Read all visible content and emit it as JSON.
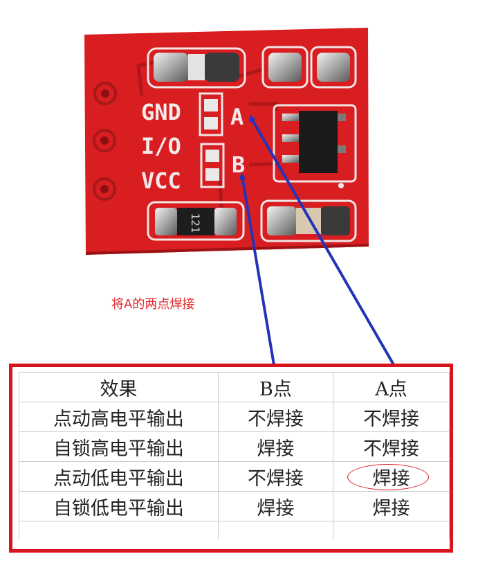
{
  "board": {
    "silkscreen": {
      "pin_labels": [
        "GND",
        "I/O",
        "VCC"
      ],
      "jumper_labels": [
        "A",
        "B"
      ],
      "resistor_code": "121"
    },
    "pcb_color": "#d81e20"
  },
  "annotation": {
    "caption": "将A的两点焊接",
    "caption_color": "#e2262b",
    "arrow_color": "#2433b8"
  },
  "table": {
    "headers": [
      "效果",
      "B点",
      "A点"
    ],
    "rows": [
      [
        "点动高电平输出",
        "不焊接",
        "不焊接"
      ],
      [
        "自锁高电平输出",
        "焊接",
        "不焊接"
      ],
      [
        "点动低电平输出",
        "不焊接",
        "焊接"
      ],
      [
        "自锁低电平输出",
        "焊接",
        "焊接"
      ]
    ],
    "highlight_color": "#d8141c"
  }
}
